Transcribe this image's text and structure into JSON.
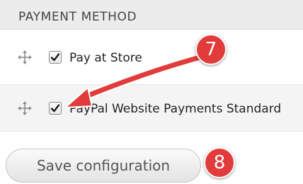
{
  "table": {
    "header": "PAYMENT METHOD",
    "rows": [
      {
        "label": "Pay at Store",
        "checked": true
      },
      {
        "label": "PayPal Website Payments Standard",
        "checked": true
      }
    ]
  },
  "actions": {
    "save_label": "Save configuration"
  },
  "annotations": {
    "step_7": "7",
    "step_8": "8",
    "color": "#e23b3b"
  },
  "icons": {
    "drag": "drag-handle-icon",
    "check": "checkmark-icon"
  }
}
